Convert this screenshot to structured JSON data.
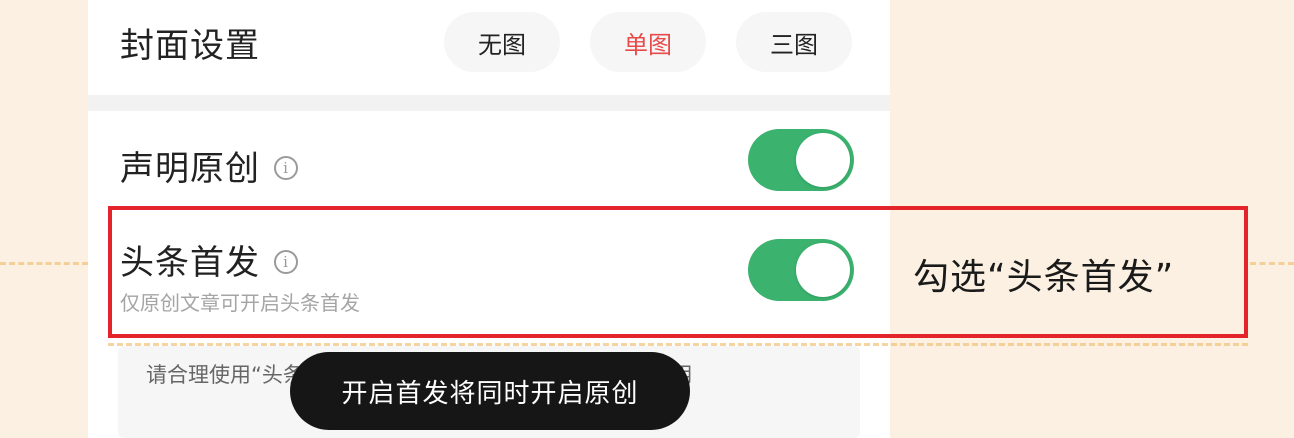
{
  "cover": {
    "title": "封面设置",
    "options": [
      "无图",
      "单图",
      "三图"
    ],
    "selected": "单图"
  },
  "declare_original": {
    "label": "声明原创",
    "enabled": true
  },
  "toutiao_first": {
    "label": "头条首发",
    "sub": "仅原创文章可开启头条首发",
    "enabled": true
  },
  "notice": {
    "text": "请合理使用“头条首发”，虚假声明将会影响对应权益的使用"
  },
  "toast": {
    "text": "开启首发将同时开启原创"
  },
  "annotation": {
    "text": "勾选“头条首发”"
  },
  "colors": {
    "accent_red": "#e84a4a",
    "toggle_green": "#3bb36f",
    "highlight_red": "#e3242b",
    "background": "#fbf0e1"
  },
  "icons": {
    "info": "info-circle-icon"
  }
}
